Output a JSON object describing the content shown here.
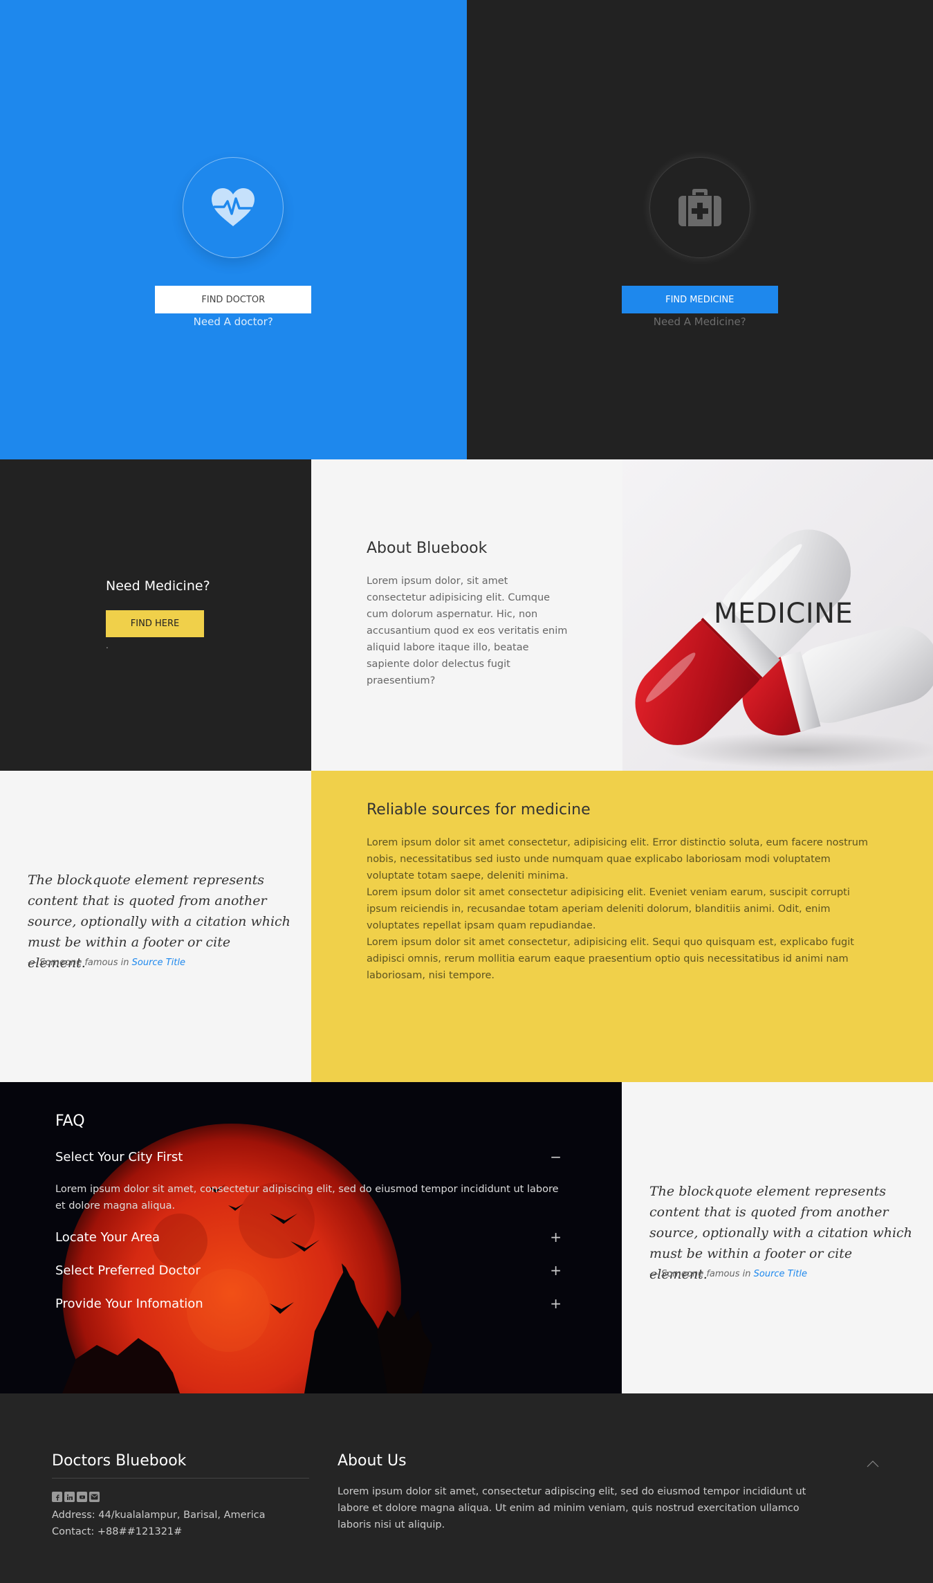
{
  "hero": {
    "left": {
      "button_label": "FIND DOCTOR",
      "subtitle": "Need A doctor?",
      "icon": "heart-pulse-icon"
    },
    "right": {
      "button_label": "FIND MEDICINE",
      "subtitle": "Need A Medicine?",
      "icon": "medical-kit-icon"
    }
  },
  "need_medicine": {
    "title": "Need Medicine?",
    "button_label": "FIND HERE",
    "dot": "."
  },
  "about": {
    "title": "About Bluebook",
    "text": "Lorem ipsum dolor, sit amet consectetur adipisicing elit. Cumque cum dolorum aspernatur. Hic, non accusantium quod ex eos veritatis enim aliquid labore itaque illo, beatae sapiente dolor delectus fugit praesentium?"
  },
  "medicine_panel": {
    "label": "MEDICINE"
  },
  "quote": {
    "text": "The blockquote element represents content that is quoted from another source, optionally with a citation which must be within a footer or cite element.",
    "cite_prefix": "— Someone famous in ",
    "cite_source": "Source Title"
  },
  "reliable": {
    "title": "Reliable sources for medicine",
    "paragraphs": [
      "Lorem ipsum dolor sit amet consectetur, adipisicing elit. Error distinctio soluta, eum facere nostrum nobis, necessitatibus sed iusto unde numquam quae explicabo laboriosam modi voluptatem voluptate totam saepe, deleniti minima.",
      "Lorem ipsum dolor sit amet consectetur adipisicing elit. Eveniet veniam earum, suscipit corrupti ipsum reiciendis in, recusandae totam aperiam deleniti dolorum, blanditiis animi. Odit, enim voluptates repellat ipsam quam repudiandae.",
      "Lorem ipsum dolor sit amet consectetur, adipisicing elit. Sequi quo quisquam est, explicabo fugit adipisci omnis, rerum mollitia earum eaque praesentium optio quis necessitatibus id animi nam laboriosam, nisi tempore."
    ]
  },
  "faq": {
    "title": "FAQ",
    "items": [
      {
        "question": "Select Your City First",
        "toggle": "−",
        "expanded": true
      },
      {
        "question": "Locate Your Area",
        "toggle": "+",
        "expanded": false
      },
      {
        "question": "Select Preferred Doctor",
        "toggle": "+",
        "expanded": false
      },
      {
        "question": "Provide Your Infomation",
        "toggle": "+",
        "expanded": false
      }
    ],
    "answer": "Lorem ipsum dolor sit amet, consectetur adipiscing elit, sed do eiusmod tempor incididunt ut labore et dolore magna aliqua."
  },
  "footer": {
    "brand": "Doctors Bluebook",
    "social_icons": [
      "facebook-icon",
      "linkedin-icon",
      "youtube-icon",
      "email-icon"
    ],
    "address": "Address: 44/kualalampur, Barisal, America",
    "contact": "Contact: +88##121321#",
    "about_title": "About Us",
    "about_text": "Lorem ipsum dolor sit amet, consectetur adipiscing elit, sed do eiusmod tempor incididunt ut labore et dolore magna aliqua. Ut enim ad minim veniam, quis nostrud exercitation ullamco laboris nisi ut aliquip."
  },
  "colors": {
    "blue": "#1e88ed",
    "dark": "#222222",
    "yellow": "#f0d04a",
    "light": "#f5f5f5"
  }
}
